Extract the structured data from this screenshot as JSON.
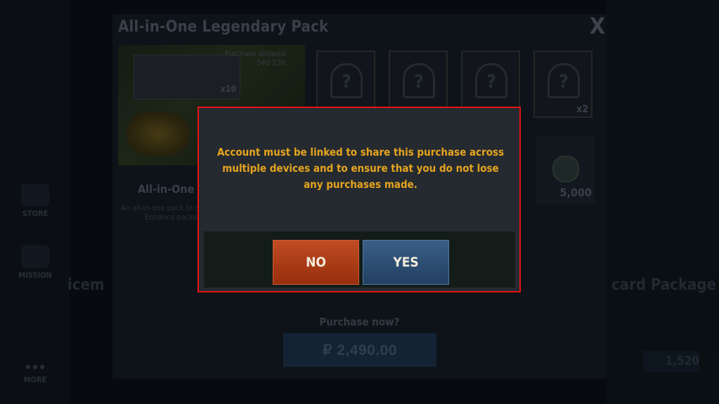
{
  "background": {
    "sidebar": {
      "items": [
        {
          "icon": "store-icon",
          "label": "STORE"
        },
        {
          "icon": "mission-icon",
          "label": "MISSION"
        },
        {
          "icon": "more-icon",
          "label": "MORE"
        }
      ]
    },
    "pack": {
      "title": "All-in-One Legendary Pack",
      "close_label": "X",
      "purchase_allowed": "Purchase allowed",
      "time_left": "54d 23h",
      "cards_multiplier": "x10",
      "name": "All-in-One",
      "description_line1": "An all-in-one pack to c",
      "description_line2": "Enhance packs a",
      "slots": [
        {
          "mystery": "?",
          "multiplier": ""
        },
        {
          "mystery": "?",
          "multiplier": ""
        },
        {
          "mystery": "?",
          "multiplier": ""
        },
        {
          "mystery": "?",
          "multiplier": "x2"
        }
      ],
      "coin_amount": "5,000",
      "purchase_prompt": "Purchase now?",
      "purchase_price": "₽ 2,490.00"
    },
    "left_partial_title": "icem",
    "right_partial_title": "card Package",
    "right_partial_price": "1,520"
  },
  "dialog": {
    "message": "Account must be linked to share this purchase across multiple devices and to ensure that you do not lose any purchases made.",
    "no_label": "NO",
    "yes_label": "YES",
    "colors": {
      "border": "#e41414",
      "message": "#e6a51e",
      "no": "#a83b16",
      "yes": "#2c4d72"
    }
  }
}
